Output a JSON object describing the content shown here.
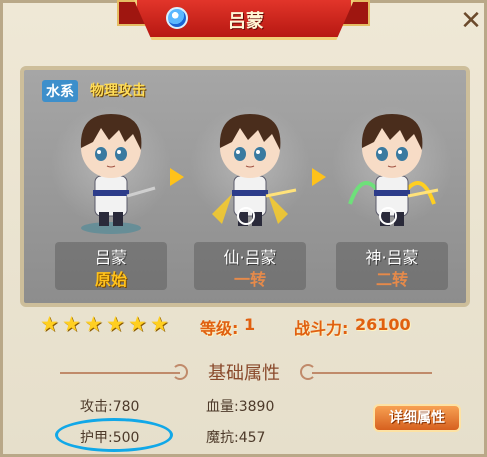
{
  "window": {
    "title": "吕蒙",
    "close_icon": "close-x-icon",
    "element_icon": "water-drop-icon"
  },
  "tags": {
    "element": "水系",
    "attack_type": "物理攻击"
  },
  "forms": [
    {
      "name": "吕蒙",
      "stage": "原始",
      "stage_color": "#ffc21a"
    },
    {
      "name": "仙·吕蒙",
      "stage": "一转",
      "stage_color": "#e68a4a"
    },
    {
      "name": "神·吕蒙",
      "stage": "二转",
      "stage_color": "#e68a4a"
    }
  ],
  "stats": {
    "stars": 6,
    "level_label": "等级:",
    "level_value": "1",
    "power_label": "战斗力:",
    "power_value": "26100"
  },
  "section": {
    "title": "基础属性"
  },
  "attributes": {
    "attack": "攻击:780",
    "hp": "血量:3890",
    "armor": "护甲:500",
    "magic_resist": "魔抗:457"
  },
  "buttons": {
    "detail": "详细属性"
  },
  "colors": {
    "banner": "#c81f16",
    "accent": "#e06010",
    "highlight": "#11a8e8"
  }
}
